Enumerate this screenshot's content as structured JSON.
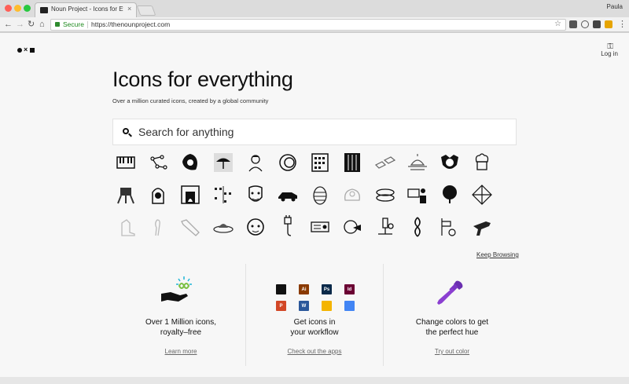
{
  "browser": {
    "tab_title": "Noun Project - Icons for Everyth",
    "tab_close": "×",
    "profile_name": "Paula",
    "secure_label": "Secure",
    "url": "https://thenounproject.com",
    "star": "☆"
  },
  "nav": {
    "back": "←",
    "forward": "→",
    "reload": "↻",
    "home": "⌂",
    "menu": "⋮"
  },
  "header": {
    "login_label": "Log in"
  },
  "hero": {
    "title": "Icons for everything",
    "subtitle": "Over a million curated icons, created by a global community"
  },
  "search": {
    "placeholder": "Search for anything"
  },
  "icon_grid": {
    "rows": [
      [
        "piano-icon",
        "molecule-icon",
        "sun-leaf-icon",
        "umbrella-icon",
        "woman-icon",
        "circle-ring-icon",
        "grid-calendar-icon",
        "bookshelf-icon",
        "tiles-icon",
        "sunset-icon",
        "dog-icon",
        "chef-hat-icon"
      ],
      [
        "walker-robot-icon",
        "helmet-icon",
        "fireplace-icon",
        "pattern-icon",
        "face-mask-icon",
        "car-icon",
        "pinecone-icon",
        "dragon-icon",
        "slippers-icon",
        "presenter-icon",
        "tree-icon",
        "network-icon"
      ],
      [
        "shoe-icon",
        "bird-icon",
        "hand-icon",
        "ufo-icon",
        "baby-face-icon",
        "plug-icon",
        "radio-icon",
        "globe-hand-icon",
        "microscope-icon",
        "knot-icon",
        "basketball-icon",
        "gun-icon"
      ]
    ],
    "keep_browsing": "Keep Browsing"
  },
  "features": [
    {
      "title_line1": "Over 1 Million icons,",
      "title_line2": "royalty–free",
      "link": "Learn more"
    },
    {
      "title_line1": "Get icons in",
      "title_line2": "your workflow",
      "link": "Check out the apps"
    },
    {
      "title_line1": "Change colors to get",
      "title_line2": "the perfect hue",
      "link": "Try out color"
    }
  ],
  "apps": [
    {
      "name": "apple-icon",
      "label": "",
      "color": "#111111"
    },
    {
      "name": "illustrator-icon",
      "label": "Ai",
      "color": "#8a3a00"
    },
    {
      "name": "photoshop-icon",
      "label": "Ps",
      "color": "#0b2a4a"
    },
    {
      "name": "indesign-icon",
      "label": "Id",
      "color": "#6b0033"
    },
    {
      "name": "powerpoint-icon",
      "label": "P",
      "color": "#d24726"
    },
    {
      "name": "word-icon",
      "label": "W",
      "color": "#2b579a"
    },
    {
      "name": "google-slides-icon",
      "label": "",
      "color": "#f4b400"
    },
    {
      "name": "google-docs-icon",
      "label": "",
      "color": "#4285f4"
    }
  ],
  "colors": {
    "accent_purple": "#8b3fd1",
    "secure_green": "#1e8a1e"
  }
}
